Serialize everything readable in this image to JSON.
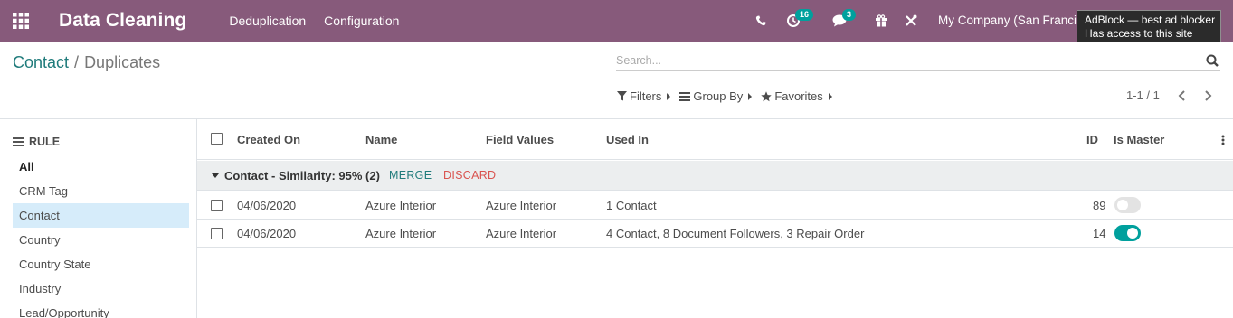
{
  "navbar": {
    "app_title": "Data Cleaning",
    "menus": [
      "Deduplication",
      "Configuration"
    ],
    "activity_count": "16",
    "message_count": "3",
    "company": "My Company (San Francisco)",
    "bg_color": "#875a7b"
  },
  "tooltip": {
    "line1": "AdBlock — best ad blocker",
    "line2": "Has access to this site"
  },
  "breadcrumb": {
    "parent": "Contact",
    "separator": "/",
    "current": "Duplicates"
  },
  "search": {
    "placeholder": "Search..."
  },
  "filters": {
    "filters_label": "Filters",
    "groupby_label": "Group By",
    "favorites_label": "Favorites"
  },
  "pager": {
    "value": "1-1 / 1"
  },
  "sidebar": {
    "header": "RULE",
    "items": [
      {
        "label": "All"
      },
      {
        "label": "CRM Tag"
      },
      {
        "label": "Contact"
      },
      {
        "label": "Country"
      },
      {
        "label": "Country State"
      },
      {
        "label": "Industry"
      },
      {
        "label": "Lead/Opportunity"
      }
    ]
  },
  "list": {
    "columns": {
      "created_on": "Created On",
      "name": "Name",
      "field_values": "Field Values",
      "used_in": "Used In",
      "id": "ID",
      "is_master": "Is Master"
    },
    "group": {
      "title": "Contact - Similarity: 95% (2)",
      "merge_label": "MERGE",
      "discard_label": "DISCARD"
    },
    "rows": [
      {
        "created_on": "04/06/2020",
        "name": "Azure Interior",
        "field_values": "Azure Interior",
        "used_in": "1 Contact",
        "id": "89",
        "is_master": false
      },
      {
        "created_on": "04/06/2020",
        "name": "Azure Interior",
        "field_values": "Azure Interior",
        "used_in": "4 Contact, 8 Document Followers, 3 Repair Order",
        "id": "14",
        "is_master": true
      }
    ]
  }
}
